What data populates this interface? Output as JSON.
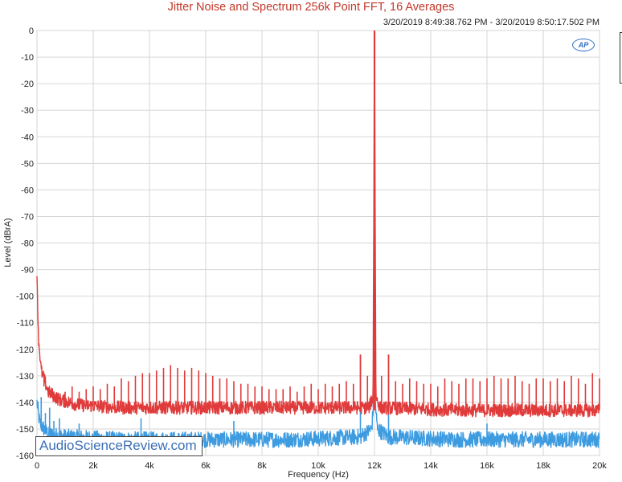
{
  "chart_data": {
    "type": "line",
    "title": "Jitter Noise and Spectrum 256k Point FFT, 16 Averages",
    "timestamp": "3/20/2019 8:49:38.762 PM - 3/20/2019 8:50:17.502 PM",
    "xlabel": "Frequency (Hz)",
    "ylabel": "Level (dBrA)",
    "xlim": [
      0,
      20000
    ],
    "ylim": [
      -160,
      0
    ],
    "x_ticks": [
      0,
      2000,
      4000,
      6000,
      8000,
      10000,
      12000,
      14000,
      16000,
      18000,
      20000
    ],
    "x_tick_labels": [
      "0",
      "2k",
      "4k",
      "6k",
      "8k",
      "10k",
      "12k",
      "14k",
      "16k",
      "18k",
      "20k"
    ],
    "y_ticks": [
      0,
      -10,
      -20,
      -30,
      -40,
      -50,
      -60,
      -70,
      -80,
      -90,
      -100,
      -110,
      -120,
      -130,
      -140,
      -150,
      -160
    ],
    "y_tick_labels": [
      "0",
      "-10",
      "-20",
      "-30",
      "-40",
      "-50",
      "-60",
      "-70",
      "-80",
      "-90",
      "-100",
      "-110",
      "-120",
      "-130",
      "-140",
      "-150",
      "-160"
    ],
    "grid": true,
    "series": [
      {
        "color": "#e03a3a",
        "noise_floor": [
          [
            0,
            -90
          ],
          [
            50,
            -115
          ],
          [
            150,
            -128
          ],
          [
            400,
            -136
          ],
          [
            800,
            -139
          ],
          [
            1500,
            -141
          ],
          [
            3000,
            -142
          ],
          [
            6000,
            -142
          ],
          [
            9000,
            -142
          ],
          [
            11800,
            -142
          ],
          [
            11950,
            -138
          ],
          [
            12000,
            0
          ],
          [
            12050,
            -138
          ],
          [
            12200,
            -142
          ],
          [
            15000,
            -143
          ],
          [
            18000,
            -143
          ],
          [
            20000,
            -143
          ]
        ],
        "spurs": [
          [
            250,
            -134
          ],
          [
            500,
            -136
          ],
          [
            750,
            -137
          ],
          [
            1000,
            -136
          ],
          [
            1250,
            -134
          ],
          [
            1500,
            -136
          ],
          [
            1750,
            -135
          ],
          [
            2000,
            -134
          ],
          [
            2250,
            -135
          ],
          [
            2500,
            -133
          ],
          [
            2750,
            -134
          ],
          [
            3000,
            -131
          ],
          [
            3250,
            -132
          ],
          [
            3500,
            -130
          ],
          [
            3750,
            -129
          ],
          [
            4000,
            -129
          ],
          [
            4250,
            -128
          ],
          [
            4500,
            -127
          ],
          [
            4750,
            -126
          ],
          [
            5000,
            -127
          ],
          [
            5250,
            -128
          ],
          [
            5500,
            -127
          ],
          [
            5750,
            -128
          ],
          [
            6000,
            -129
          ],
          [
            6250,
            -130
          ],
          [
            6500,
            -131
          ],
          [
            6750,
            -131
          ],
          [
            7000,
            -132
          ],
          [
            7250,
            -133
          ],
          [
            7500,
            -133
          ],
          [
            7750,
            -134
          ],
          [
            8000,
            -134
          ],
          [
            8250,
            -135
          ],
          [
            8500,
            -135
          ],
          [
            8750,
            -135
          ],
          [
            9000,
            -134
          ],
          [
            9250,
            -136
          ],
          [
            9500,
            -134
          ],
          [
            9750,
            -133
          ],
          [
            10000,
            -135
          ],
          [
            10250,
            -133
          ],
          [
            10500,
            -134
          ],
          [
            10750,
            -133
          ],
          [
            11000,
            -132
          ],
          [
            11250,
            -133
          ],
          [
            11500,
            -122
          ],
          [
            11750,
            -130
          ],
          [
            12250,
            -130
          ],
          [
            12500,
            -122
          ],
          [
            12750,
            -132
          ],
          [
            13000,
            -133
          ],
          [
            13250,
            -131
          ],
          [
            13500,
            -132
          ],
          [
            13750,
            -133
          ],
          [
            14000,
            -133
          ],
          [
            14250,
            -134
          ],
          [
            14500,
            -131
          ],
          [
            14750,
            -132
          ],
          [
            15000,
            -133
          ],
          [
            15250,
            -131
          ],
          [
            15500,
            -131
          ],
          [
            15750,
            -132
          ],
          [
            16000,
            -131
          ],
          [
            16250,
            -130
          ],
          [
            16500,
            -131
          ],
          [
            16750,
            -131
          ],
          [
            17000,
            -130
          ],
          [
            17250,
            -132
          ],
          [
            17500,
            -133
          ],
          [
            17750,
            -131
          ],
          [
            18000,
            -131
          ],
          [
            18250,
            -132
          ],
          [
            18500,
            -131
          ],
          [
            18750,
            -132
          ],
          [
            19000,
            -130
          ],
          [
            19250,
            -131
          ],
          [
            19500,
            -133
          ],
          [
            19750,
            -129
          ],
          [
            20000,
            -131
          ]
        ]
      },
      {
        "color": "#3d9be0",
        "noise_floor": [
          [
            0,
            -140
          ],
          [
            100,
            -148
          ],
          [
            400,
            -152
          ],
          [
            1000,
            -153
          ],
          [
            3000,
            -154
          ],
          [
            6000,
            -154
          ],
          [
            9000,
            -154
          ],
          [
            11500,
            -153
          ],
          [
            11900,
            -150
          ],
          [
            11970,
            -140
          ],
          [
            12000,
            -128
          ],
          [
            12030,
            -140
          ],
          [
            12100,
            -150
          ],
          [
            12500,
            -153
          ],
          [
            15000,
            -154
          ],
          [
            20000,
            -154
          ]
        ],
        "spurs": [
          [
            150,
            -138
          ],
          [
            300,
            -144
          ],
          [
            450,
            -142
          ],
          [
            600,
            -147
          ],
          [
            800,
            -146
          ],
          [
            1500,
            -148
          ],
          [
            3700,
            -146
          ],
          [
            11500,
            -122
          ],
          [
            12500,
            -122
          ],
          [
            7000,
            -147
          ],
          [
            16000,
            -148
          ]
        ]
      }
    ]
  },
  "watermark": "AudioScienceReview.com",
  "logo_text": "AP"
}
